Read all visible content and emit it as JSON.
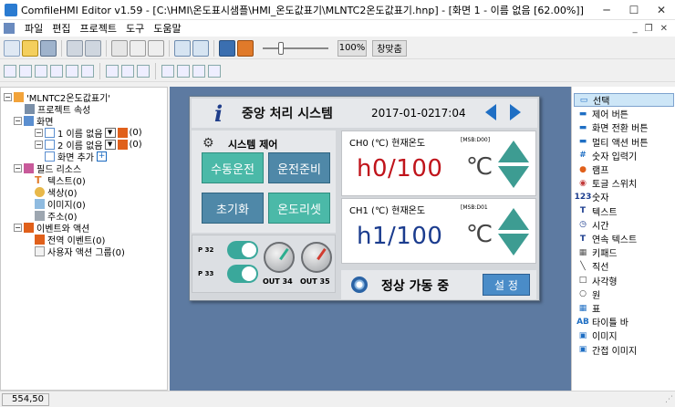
{
  "window": {
    "title": "ComfileHMI Editor v1.59 - [C:\\HMI\\온도표시샘플\\HMI_온도값표기\\MLNTC2온도값표기.hnp] - [화면 1 - 이름 없음 [62.00%]]",
    "controls": {
      "minimize": "─",
      "maximize": "☐",
      "close": "✕"
    },
    "mdi_controls": {
      "minimize": "_",
      "restore": "❐",
      "close": "✕"
    }
  },
  "menu": {
    "items": [
      "파일",
      "편집",
      "프로젝트",
      "도구",
      "도움말"
    ]
  },
  "toolbar": {
    "zoom_label": "100%",
    "fit_label": "창맞춤",
    "zoom_slider_level": 0.3
  },
  "tree": {
    "project": "'MLNTC2온도값표기'",
    "project_props": "프로젝트 속성",
    "screens": "화면",
    "screen1": "1 이름 없음",
    "screen1_count": "(0)",
    "screen2": "2 이름 없음",
    "screen2_count": "(0)",
    "add_screen": "화면 추가",
    "field_resources": "필드 리소스",
    "text": "텍스트(0)",
    "color": "색상(0)",
    "image": "이미지(0)",
    "address": "주소(0)",
    "events": "이벤트와 액션",
    "global_event": "전역 이벤트(0)",
    "user_action_group": "사용자 액션 그룹(0)",
    "expander_collapse": "−",
    "dropdown_glyph": "▼",
    "add_glyph": "+"
  },
  "hmi": {
    "info_icon": "i",
    "title": "중앙 처리 시스템",
    "date": "2017-01-02",
    "time": "17:04",
    "system_control_icon": "⚙",
    "system_control": "시스템 제어",
    "buttons": {
      "manual_run": "수동운전",
      "run_prep": "운전준비",
      "init": "초기화",
      "temp_reset": "온도리셋"
    },
    "io": {
      "p32": "P 32",
      "p33": "P 33",
      "out34": "OUT 34",
      "out35": "OUT 35"
    },
    "ch0": {
      "label": "CH0 (℃) 현재온도",
      "msb": "[MSB:D00]",
      "value": "h0/100",
      "unit": "℃"
    },
    "ch1": {
      "label": "CH1 (℃) 현재온도",
      "msb": "[MSB:D01",
      "value": "h1/100",
      "unit": "℃"
    },
    "status": "정상 가동 중",
    "setting_button": "설 정",
    "colors": {
      "ch0_value": "#c0141b",
      "ch1_value": "#1b3c8e"
    }
  },
  "palette": {
    "items": [
      {
        "label": "선택",
        "icon": "select-icon",
        "glyph": "▭",
        "selected": true
      },
      {
        "label": "제어 버튼",
        "icon": "control-button-icon",
        "glyph": "▬"
      },
      {
        "label": "화면 전환 버튼",
        "icon": "screen-switch-button-icon",
        "glyph": "▬"
      },
      {
        "label": "멀티 액션 버튼",
        "icon": "multi-action-button-icon",
        "glyph": "▬"
      },
      {
        "label": "숫자 입력기",
        "icon": "number-input-icon",
        "glyph": "#"
      },
      {
        "label": "램프",
        "icon": "lamp-icon",
        "glyph": "●"
      },
      {
        "label": "토글 스위치",
        "icon": "toggle-switch-icon",
        "glyph": "◉"
      },
      {
        "label": "숫자",
        "icon": "number-icon",
        "glyph": "123"
      },
      {
        "label": "텍스트",
        "icon": "text-icon",
        "glyph": "T"
      },
      {
        "label": "시간",
        "icon": "clock-icon",
        "glyph": "◷"
      },
      {
        "label": "연속 텍스트",
        "icon": "scroll-text-icon",
        "glyph": "T"
      },
      {
        "label": "키패드",
        "icon": "keypad-icon",
        "glyph": "▦"
      },
      {
        "label": "직선",
        "icon": "line-icon",
        "glyph": "╲"
      },
      {
        "label": "사각형",
        "icon": "rectangle-icon",
        "glyph": "□"
      },
      {
        "label": "원",
        "icon": "circle-icon",
        "glyph": "○"
      },
      {
        "label": "표",
        "icon": "table-icon",
        "glyph": "▦"
      },
      {
        "label": "타이틀 바",
        "icon": "title-bar-icon",
        "glyph": "AB"
      },
      {
        "label": "이미지",
        "icon": "image-icon",
        "glyph": "▣"
      },
      {
        "label": "간접 이미지",
        "icon": "indirect-image-icon",
        "glyph": "▣"
      }
    ]
  },
  "statusbar": {
    "coords": "554,50"
  }
}
